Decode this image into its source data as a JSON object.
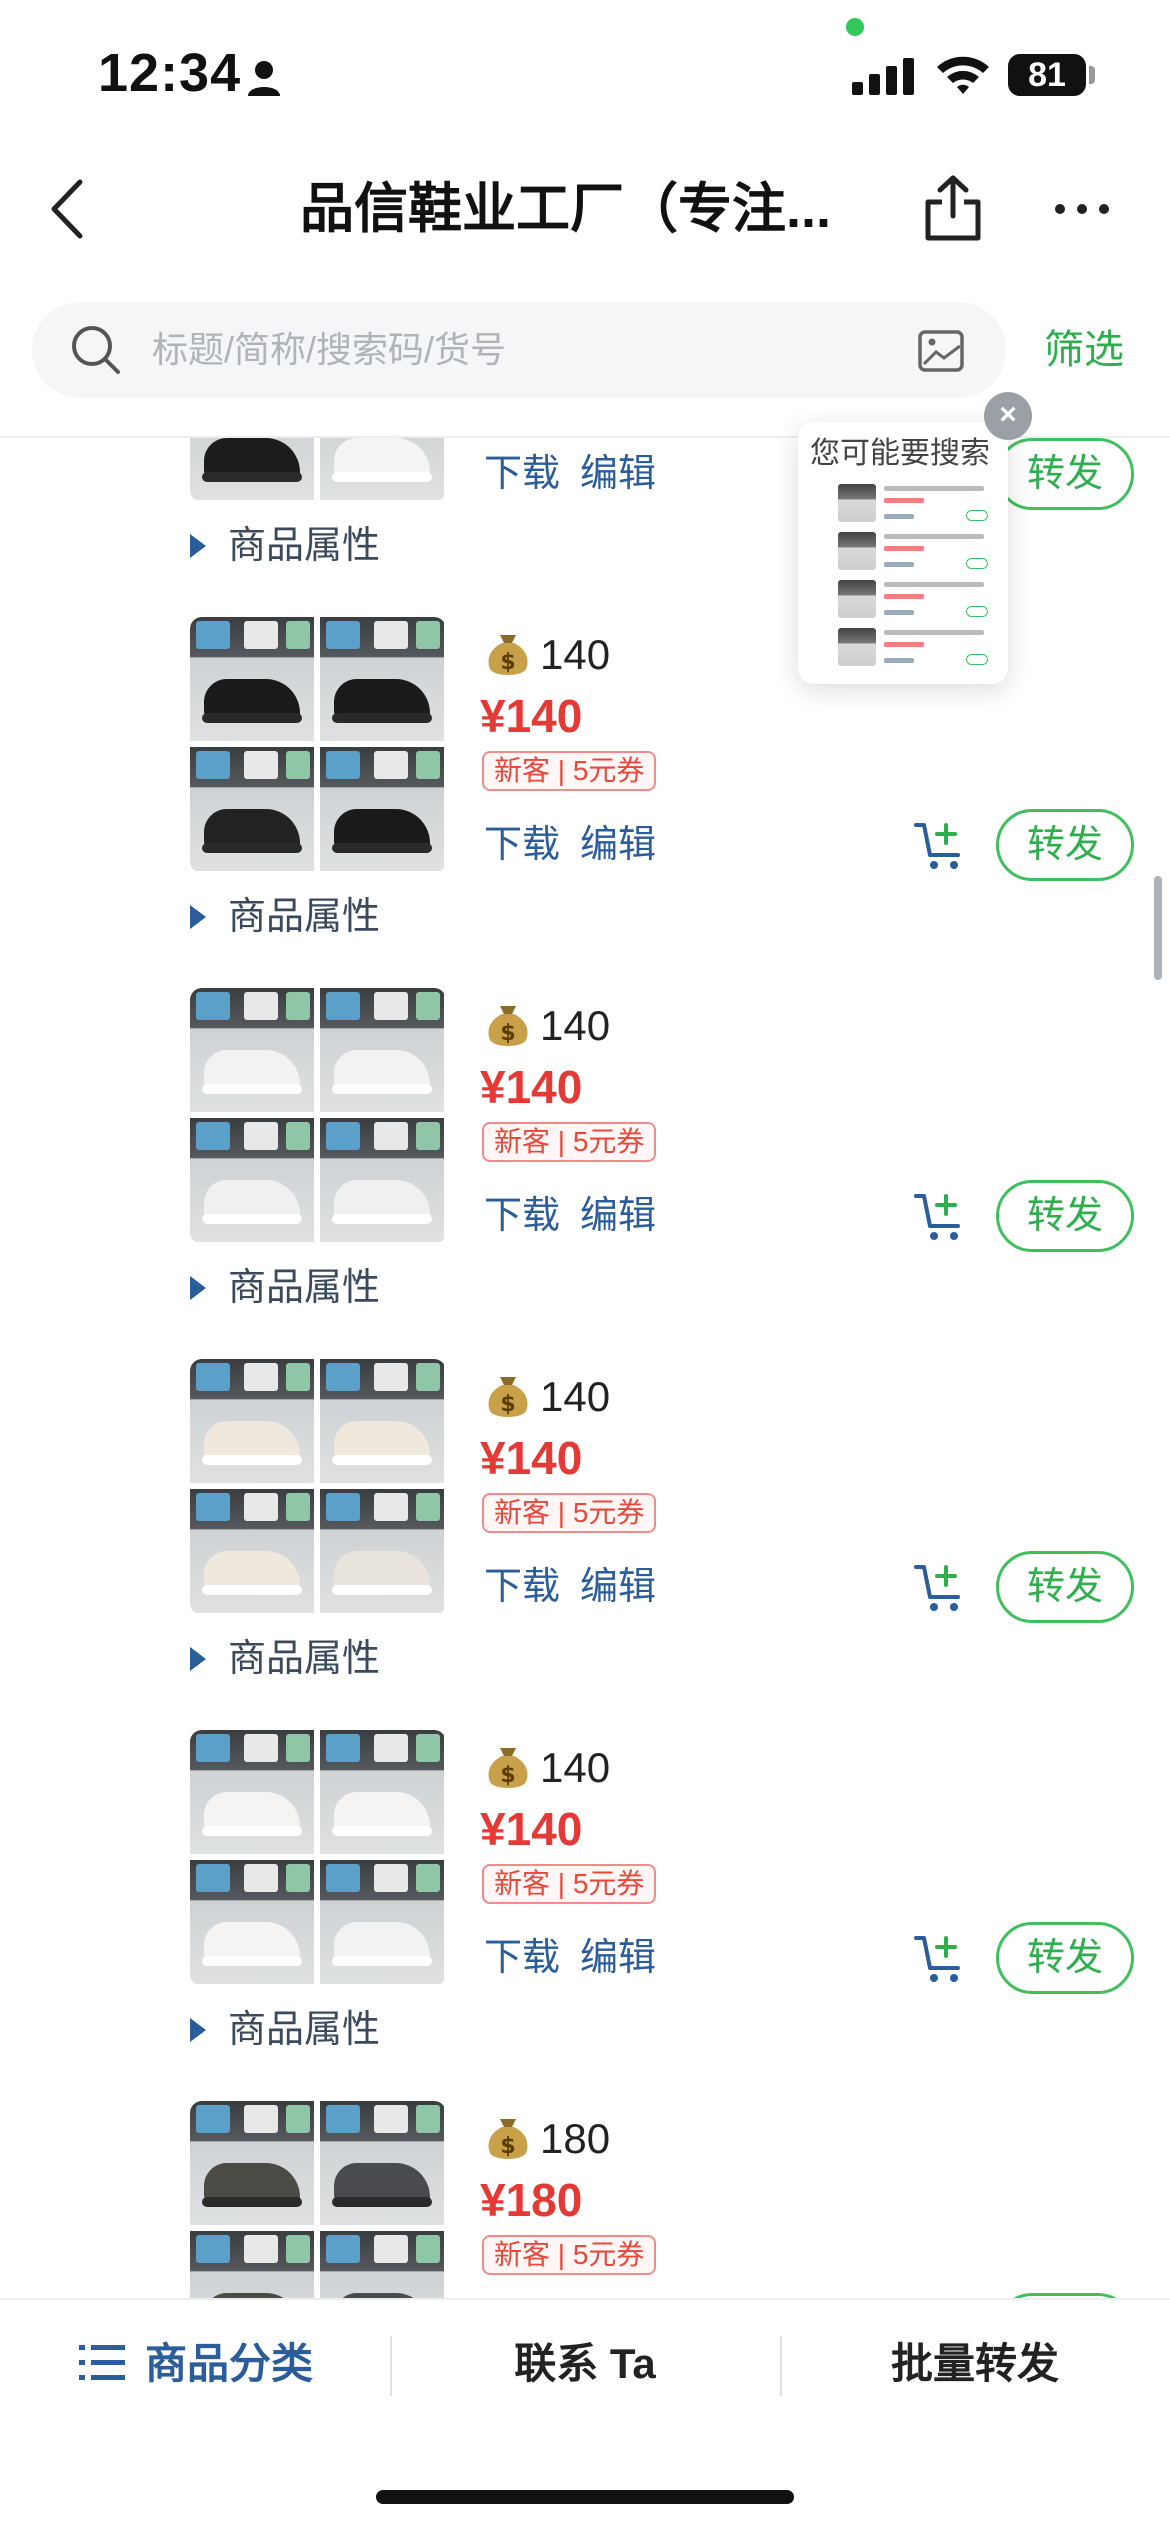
{
  "status_bar": {
    "time": "12:34",
    "battery": "81"
  },
  "nav": {
    "title": "品信鞋业工厂（专注..."
  },
  "search": {
    "placeholder": "标题/简称/搜索码/货号",
    "filter_label": "筛选"
  },
  "suggest_popup": {
    "title": "您可能要搜索",
    "close_label": "×"
  },
  "product_common": {
    "coupon": "新客 | 5元券",
    "download_label": "下载",
    "edit_label": "编辑",
    "forward_label": "转发",
    "attr_label": "商品属性"
  },
  "products": [
    {
      "cost": "",
      "price": "",
      "shoe_colors": [
        "#1c1c1c",
        "#f4f4f4",
        "#1c1c1c",
        "#f4f4f4"
      ]
    },
    {
      "cost": "140",
      "price": "¥140",
      "shoe_colors": [
        "#1a1a1a",
        "#1a1a1a",
        "#222222",
        "#1a1a1a"
      ]
    },
    {
      "cost": "140",
      "price": "¥140",
      "shoe_colors": [
        "#f2f2f2",
        "#f2f2f2",
        "#f0f0f0",
        "#f0f0f0"
      ]
    },
    {
      "cost": "140",
      "price": "¥140",
      "shoe_colors": [
        "#efe9dd",
        "#efe9dd",
        "#efe9dd",
        "#e8e4dc"
      ]
    },
    {
      "cost": "140",
      "price": "¥140",
      "shoe_colors": [
        "#f6f3f3",
        "#f6f3f3",
        "#f6f3f3",
        "#f2f2f2"
      ]
    },
    {
      "cost": "180",
      "price": "¥180",
      "shoe_colors": [
        "#4b4a44",
        "#4a4b4f",
        "#4b4a44",
        "#4a4b4f"
      ]
    }
  ],
  "bottom_bar": {
    "category_label": "商品分类",
    "contact_label": "联系 Ta",
    "batch_forward_label": "批量转发"
  },
  "colors": {
    "accent_green": "#2fae4d",
    "link_blue": "#2b5d9a",
    "price_red": "#e53935"
  }
}
